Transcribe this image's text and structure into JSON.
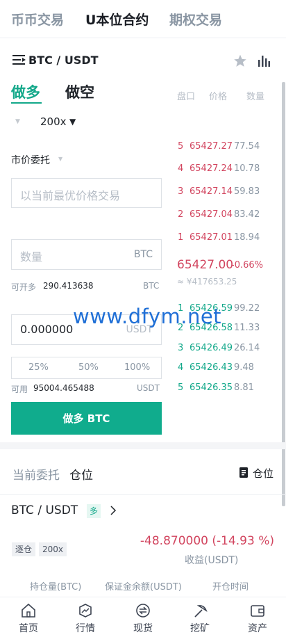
{
  "top_tabs": [
    "币币交易",
    "U本位合约",
    "期权交易"
  ],
  "pair": {
    "name": "BTC / USDT"
  },
  "side_tabs": {
    "long": "做多",
    "short": "做空"
  },
  "leverage": "200x",
  "order_type": "市价委托",
  "price_input": {
    "placeholder": "以当前最优价格交易"
  },
  "amount_input": {
    "placeholder": "数量",
    "unit": "BTC"
  },
  "openable": {
    "label": "可开多",
    "value": "290.413638",
    "unit": "BTC"
  },
  "margin_input": {
    "value": "0.000000",
    "unit": "USDT"
  },
  "percent_buttons": [
    "25%",
    "50%",
    "100%"
  ],
  "available": {
    "label": "可用",
    "value": "95004.465488",
    "unit": "USDT"
  },
  "submit_button": "做多 BTC",
  "orderbook": {
    "headers": [
      "盘口",
      "价格",
      "数量"
    ],
    "asks": [
      {
        "level": "5",
        "price": "65427.27",
        "qty": "77.54"
      },
      {
        "level": "4",
        "price": "65427.24",
        "qty": "10.78"
      },
      {
        "level": "3",
        "price": "65427.14",
        "qty": "59.83"
      },
      {
        "level": "2",
        "price": "65427.04",
        "qty": "83.42"
      },
      {
        "level": "1",
        "price": "65427.01",
        "qty": "18.94"
      }
    ],
    "last_price": "65427.00",
    "change": "-0.66%",
    "cny_price": "≈ ¥417653.25",
    "bids": [
      {
        "level": "1",
        "price": "65426.59",
        "qty": "99.22"
      },
      {
        "level": "2",
        "price": "65426.58",
        "qty": "11.33"
      },
      {
        "level": "3",
        "price": "65426.49",
        "qty": "26.14"
      },
      {
        "level": "4",
        "price": "65426.43",
        "qty": "9.48"
      },
      {
        "level": "5",
        "price": "65426.35",
        "qty": "8.81"
      }
    ]
  },
  "watermark": "www.dfym.net",
  "orders_section": {
    "tab_current": "当前委托",
    "tab_positions": "仓位",
    "positions_link": "仓位"
  },
  "position": {
    "pair": "BTC / USDT",
    "side_badge": "多",
    "margin_mode": "逐仓",
    "leverage": "200x",
    "pnl": "-48.870000 (-14.93 %)",
    "pnl_label": "收益(USDT)",
    "columns": [
      "持仓量(BTC)",
      "保证金余额(USDT)",
      "开仓时间"
    ]
  },
  "bottom_nav": [
    {
      "label": "首页",
      "icon": "home-icon"
    },
    {
      "label": "行情",
      "icon": "market-icon"
    },
    {
      "label": "现货",
      "icon": "spot-icon"
    },
    {
      "label": "挖矿",
      "icon": "mining-icon"
    },
    {
      "label": "资产",
      "icon": "wallet-icon"
    }
  ],
  "colors": {
    "green": "#13a88a",
    "red": "#d2455f",
    "button": "#10ac8d"
  }
}
